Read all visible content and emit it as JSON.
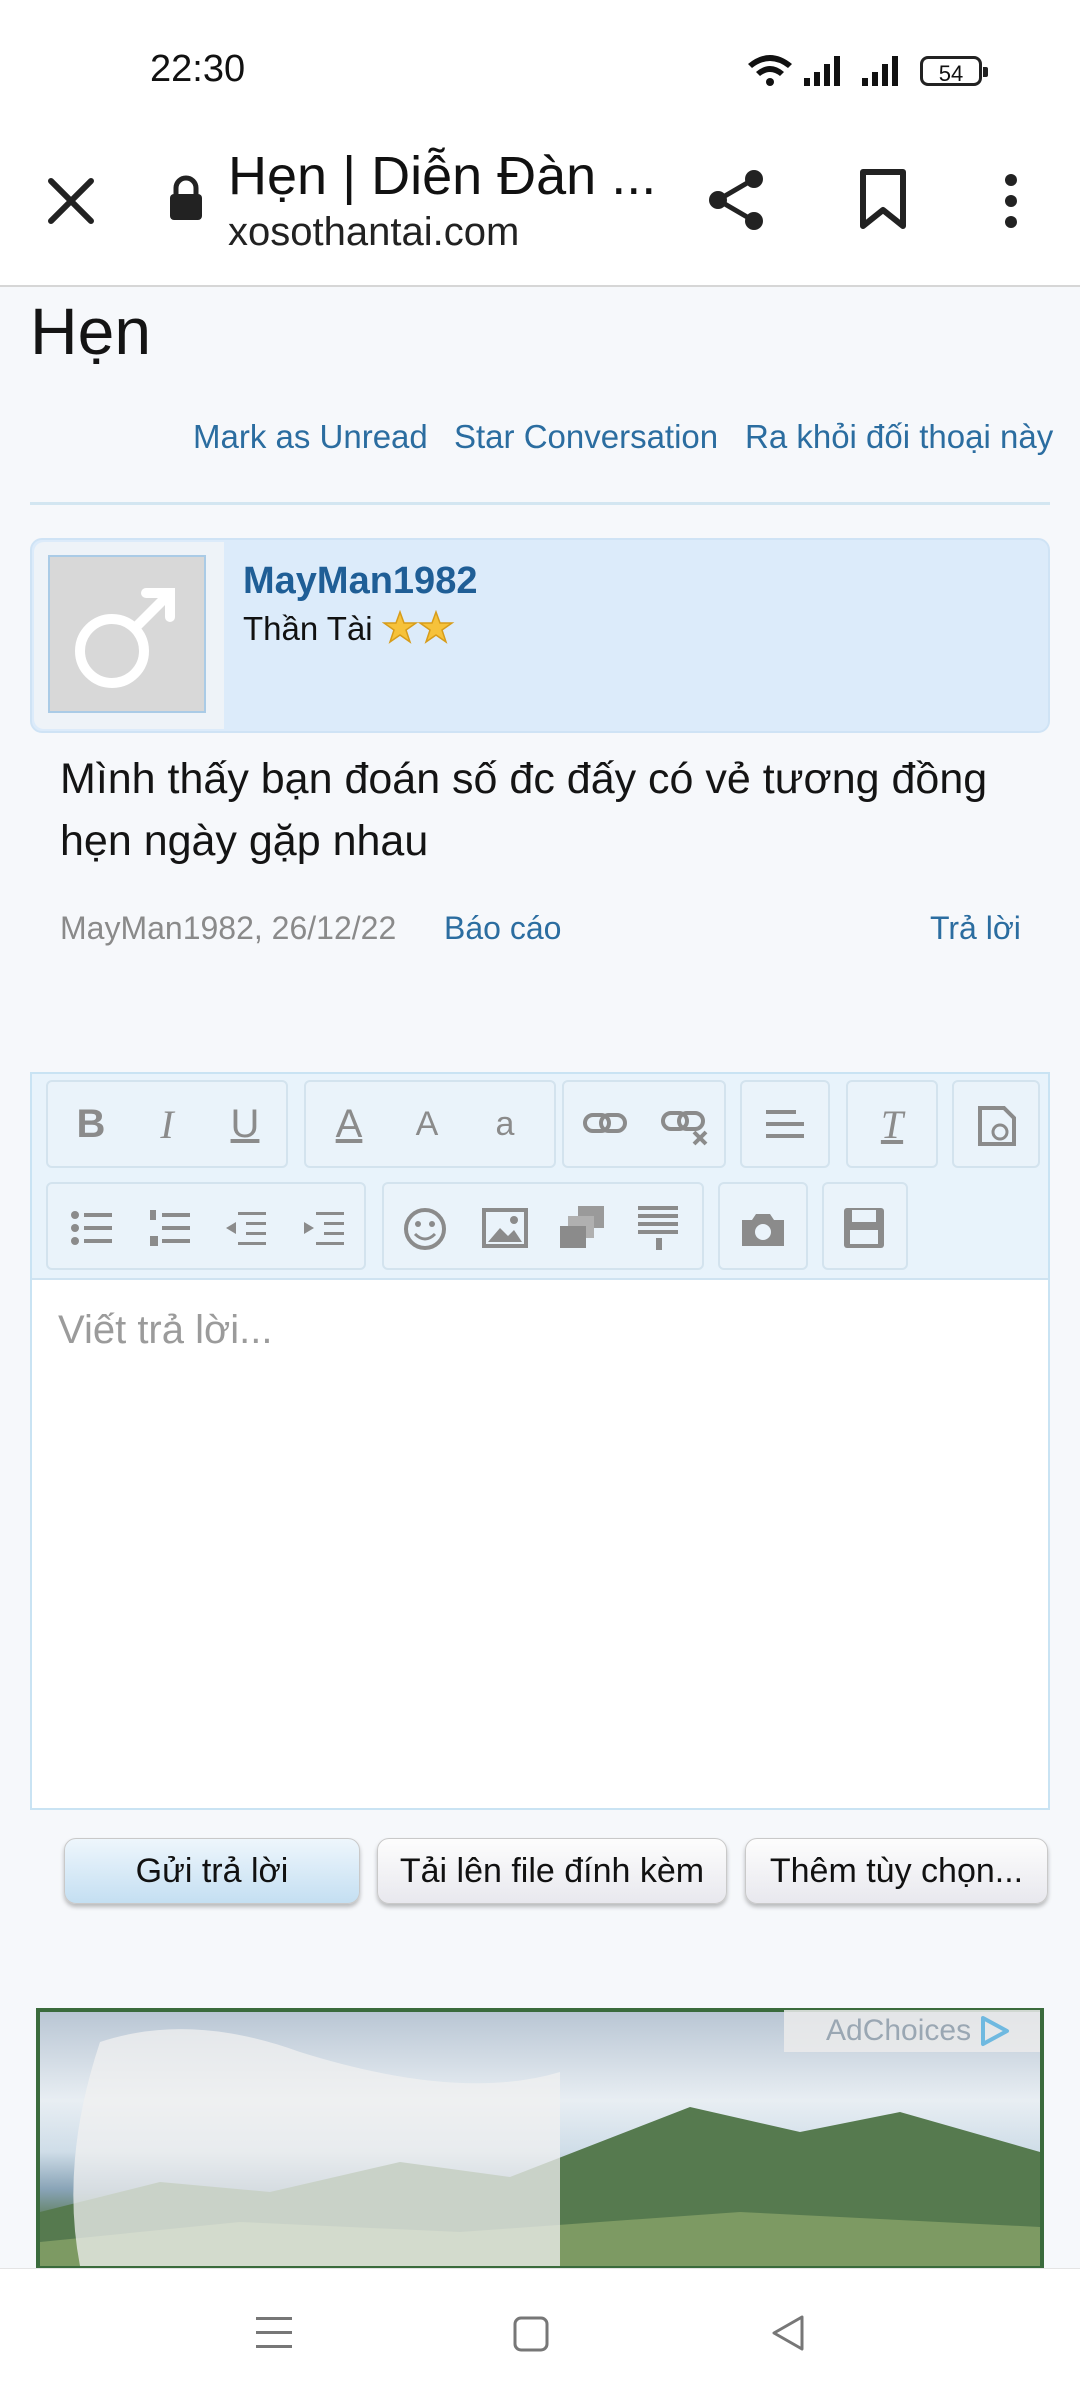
{
  "status_bar": {
    "time": "22:30",
    "battery": "54"
  },
  "browser": {
    "page_title": "Hẹn | Diễn Đàn ...",
    "url": "xosothantai.com",
    "icons": [
      "close-icon",
      "lock-icon",
      "share-icon",
      "bookmark-icon",
      "more-vert-icon"
    ]
  },
  "conversation": {
    "title": "Hẹn",
    "actions": {
      "mark_unread": "Mark as Unread",
      "star": "Star Conversation",
      "leave": "Ra khỏi đối thoại này"
    }
  },
  "message": {
    "username": "MayMan1982",
    "user_title": "Thần Tài",
    "text": "Mình thấy bạn đoán số đc đấy có vẻ tương đồng hẹn ngày gặp nhau",
    "meta": "MayMan1982, 26/12/22",
    "report": "Báo cáo",
    "reply": "Trả lời"
  },
  "editor": {
    "placeholder": "Viết trả lời...",
    "toolbar_icons": [
      "bold",
      "italic",
      "underline",
      "text-color",
      "font-size",
      "font-family",
      "link",
      "unlink",
      "align",
      "remove-format",
      "smilie-insert",
      "bullet-list",
      "numbered-list",
      "outdent",
      "indent",
      "smilie",
      "image",
      "media",
      "quote",
      "camera",
      "save"
    ],
    "bold_glyph": "B",
    "italic_glyph": "I",
    "underline_glyph": "U",
    "text_color_glyph": "A",
    "font_size_glyph": "A",
    "font_glyph": "a",
    "remove_format_glyph": "T"
  },
  "buttons": {
    "submit": "Gửi trả lời",
    "upload": "Tải lên file đính kèm",
    "more": "Thêm tùy chọn..."
  },
  "ad": {
    "adchoices": "AdChoices"
  },
  "colors": {
    "link": "#2b6da0",
    "username": "#1f5e96",
    "card_bg": "#dcebfa"
  }
}
